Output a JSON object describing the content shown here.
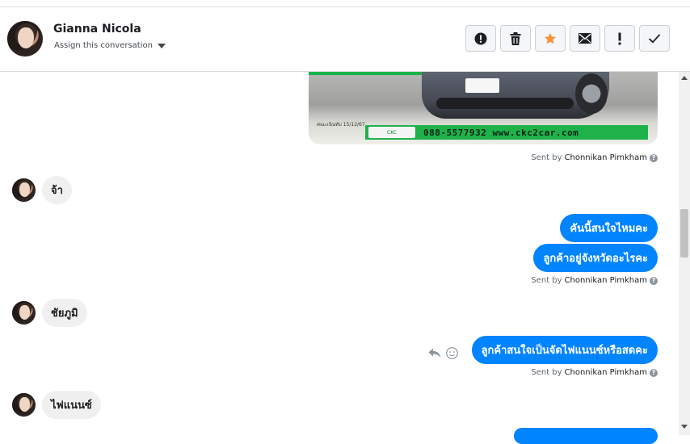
{
  "header": {
    "contact_name": "Gianna Nicola",
    "assign_label": "Assign this conversation"
  },
  "toolbar": {
    "buttons": [
      {
        "name": "mark-spam",
        "icon": "alert-circle-icon"
      },
      {
        "name": "delete",
        "icon": "trash-icon"
      },
      {
        "name": "star",
        "icon": "star-icon",
        "color": "#f7923b"
      },
      {
        "name": "mark-unread",
        "icon": "envelope-icon"
      },
      {
        "name": "follow-up",
        "icon": "exclamation-icon"
      },
      {
        "name": "mark-done",
        "icon": "check-icon"
      }
    ]
  },
  "image_message": {
    "phone": "088-5577932 www.ckc2car.com",
    "caption_small": "ค่ณะเนินทับ 15/12/67"
  },
  "messages": {
    "sent_by_prefix": "Sent by",
    "agent_name": "Chonnikan Pimkham",
    "in1": "จ้า",
    "out1": "คันนี้สนใจไหมคะ",
    "out2": "ลูกค้าอยู่จังหวัดอะไรคะ",
    "in2": "ชัยภูมิ",
    "out3": "ลูกค้าสนใจเป็นจัดไฟแนนซ์หรือสดคะ",
    "in3": "ไฟแนนซ์"
  },
  "colors": {
    "outgoing_bubble": "#0084ff",
    "incoming_bubble": "#f1f0f0",
    "banner_green": "#1fb24b"
  }
}
